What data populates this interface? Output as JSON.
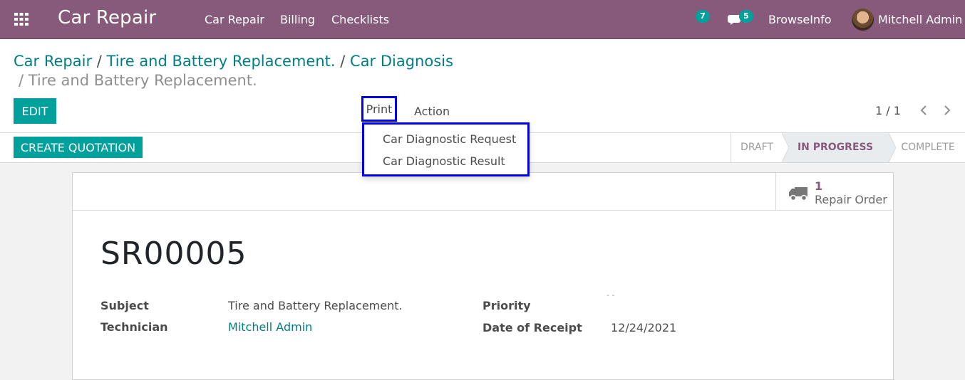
{
  "navbar": {
    "apps_icon": "apps-grid-icon",
    "brand": "Car Repair",
    "menu": [
      "Car Repair",
      "Billing",
      "Checklists"
    ],
    "activity_count": "7",
    "messages_count": "5",
    "company": "BrowseInfo",
    "user": "Mitchell Admin",
    "accent": "#875a7b"
  },
  "breadcrumb": {
    "items": [
      "Car Repair",
      "Tire and Battery Replacement.",
      "Car Diagnosis"
    ],
    "separator": "/",
    "current": "/ Tire and Battery Replacement."
  },
  "toolbar": {
    "edit_label": "EDIT",
    "print_label": "Print",
    "action_label": "Action",
    "pager": "1 / 1"
  },
  "print_menu": {
    "items": [
      "Car Diagnostic Request",
      "Car Diagnostic Result"
    ]
  },
  "statusbar": {
    "create_quotation_label": "CREATE QUOTATION",
    "stages": [
      "DRAFT",
      "IN PROGRESS",
      "COMPLETE"
    ],
    "active_stage": "IN PROGRESS"
  },
  "smart_button": {
    "count": "1",
    "label": "Repair Order",
    "icon": "truck-icon"
  },
  "record": {
    "name": "SR00005",
    "fields": {
      "subject_label": "Subject",
      "subject_value": "Tire and Battery Replacement.",
      "technician_label": "Technician",
      "technician_value": "Mitchell Admin",
      "priority_label": "Priority",
      "date_label": "Date of Receipt",
      "date_value": "12/24/2021"
    }
  }
}
